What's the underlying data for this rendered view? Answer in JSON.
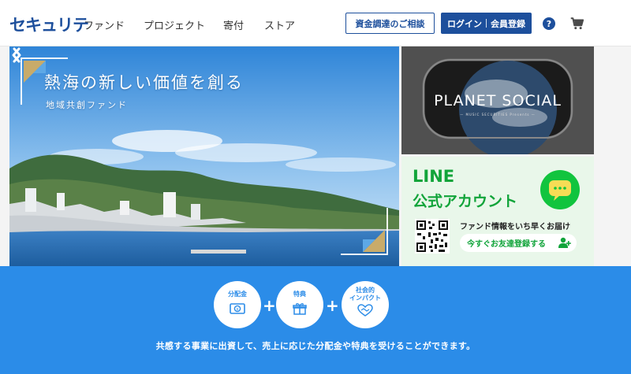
{
  "header": {
    "logo": "セキュリテ",
    "nav": [
      "ファンド",
      "プロジェクト",
      "寄付",
      "ストア"
    ],
    "consult_label": "資金調達のご相談",
    "login_label": "ログイン",
    "register_label": "会員登録",
    "help_label": "?",
    "accent": "#1d4f9c",
    "icons": [
      "help-icon",
      "cart-icon"
    ]
  },
  "hero": {
    "title": "熱海の新しい価値を創る",
    "subtitle": "地域共創ファンド",
    "icons": [
      "arrow-left-icon",
      "arrow-right-icon"
    ]
  },
  "banners": {
    "planet": {
      "title": "PLANET SOCIAL",
      "tagline": "— MUSIC SECURITIES Presents —"
    },
    "line": {
      "title_line1": "LINE",
      "title_line2": "公式アカウント",
      "description": "ファンド情報をいち早くお届け",
      "cta": "今すぐお友達登録する",
      "color": "#11a43a",
      "icons": [
        "line-chat-icon",
        "qr-code",
        "add-user-icon"
      ]
    }
  },
  "features": {
    "items": [
      {
        "label_line1": "分配金",
        "label_line2": "",
        "icon": "yen-bill-icon"
      },
      {
        "label_line1": "特典",
        "label_line2": "",
        "icon": "gift-icon"
      },
      {
        "label_line1": "社会的",
        "label_line2": "インパクト",
        "icon": "handshake-heart-icon"
      }
    ],
    "plus": "+",
    "caption": "共感する事業に出資して、売上に応じた分配金や特典を受けることができます。",
    "color": "#2b8ce8"
  }
}
